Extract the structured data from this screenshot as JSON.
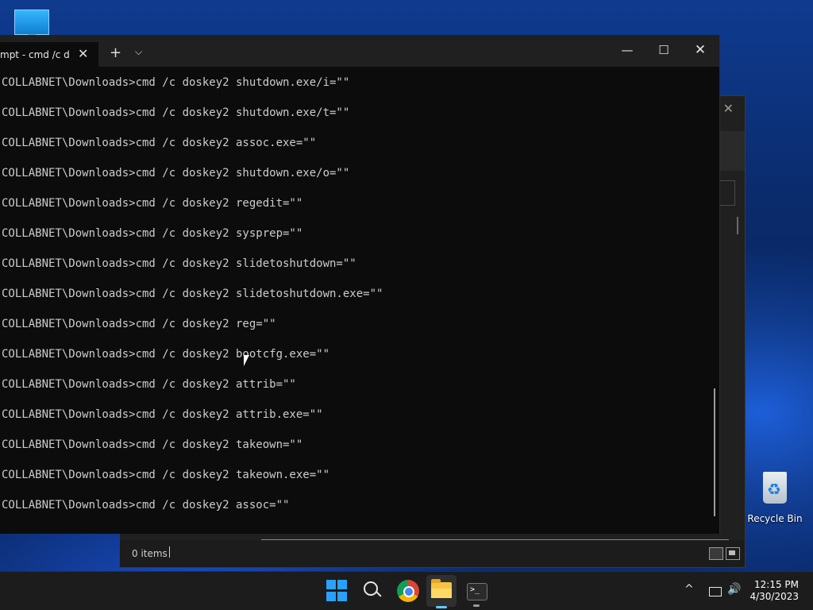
{
  "terminal": {
    "tab_title": "mpt - cmd  /c d",
    "tab_close_glyph": "✕",
    "new_tab_glyph": "+",
    "tab_dropdown_glyph": "⌵",
    "minimize_glyph": "—",
    "maximize_glyph": "☐",
    "close_glyph": "✕",
    "lines": [
      "COLLABNET\\Downloads>cmd /c doskey2 shutdown.exe/i=\"\"",
      "COLLABNET\\Downloads>cmd /c doskey2 shutdown.exe/t=\"\"",
      "COLLABNET\\Downloads>cmd /c doskey2 assoc.exe=\"\"",
      "COLLABNET\\Downloads>cmd /c doskey2 shutdown.exe/o=\"\"",
      "COLLABNET\\Downloads>cmd /c doskey2 regedit=\"\"",
      "COLLABNET\\Downloads>cmd /c doskey2 sysprep=\"\"",
      "COLLABNET\\Downloads>cmd /c doskey2 slidetoshutdown=\"\"",
      "COLLABNET\\Downloads>cmd /c doskey2 slidetoshutdown.exe=\"\"",
      "COLLABNET\\Downloads>cmd /c doskey2 reg=\"\"",
      "COLLABNET\\Downloads>cmd /c doskey2 bootcfg.exe=\"\"",
      "COLLABNET\\Downloads>cmd /c doskey2 attrib=\"\"",
      "COLLABNET\\Downloads>cmd /c doskey2 attrib.exe=\"\"",
      "COLLABNET\\Downloads>cmd /c doskey2 takeown=\"\"",
      "COLLABNET\\Downloads>cmd /c doskey2 takeown.exe=\"\"",
      "COLLABNET\\Downloads>cmd /c doskey2 assoc=\"\""
    ]
  },
  "explorer": {
    "status_items": "0 items",
    "close_glyph": "✕"
  },
  "desktop": {
    "recycle_bin_label": "Recycle Bin"
  },
  "taskbar": {
    "tray_chevron": "^",
    "volume_glyph": "🔊",
    "time": "12:15 PM",
    "date": "4/30/2023"
  },
  "colors": {
    "start_blue": "#2aa0ff",
    "terminal_bg": "#0c0c0c",
    "terminal_text": "#cccccc",
    "active_indicator": "#60cdff"
  }
}
